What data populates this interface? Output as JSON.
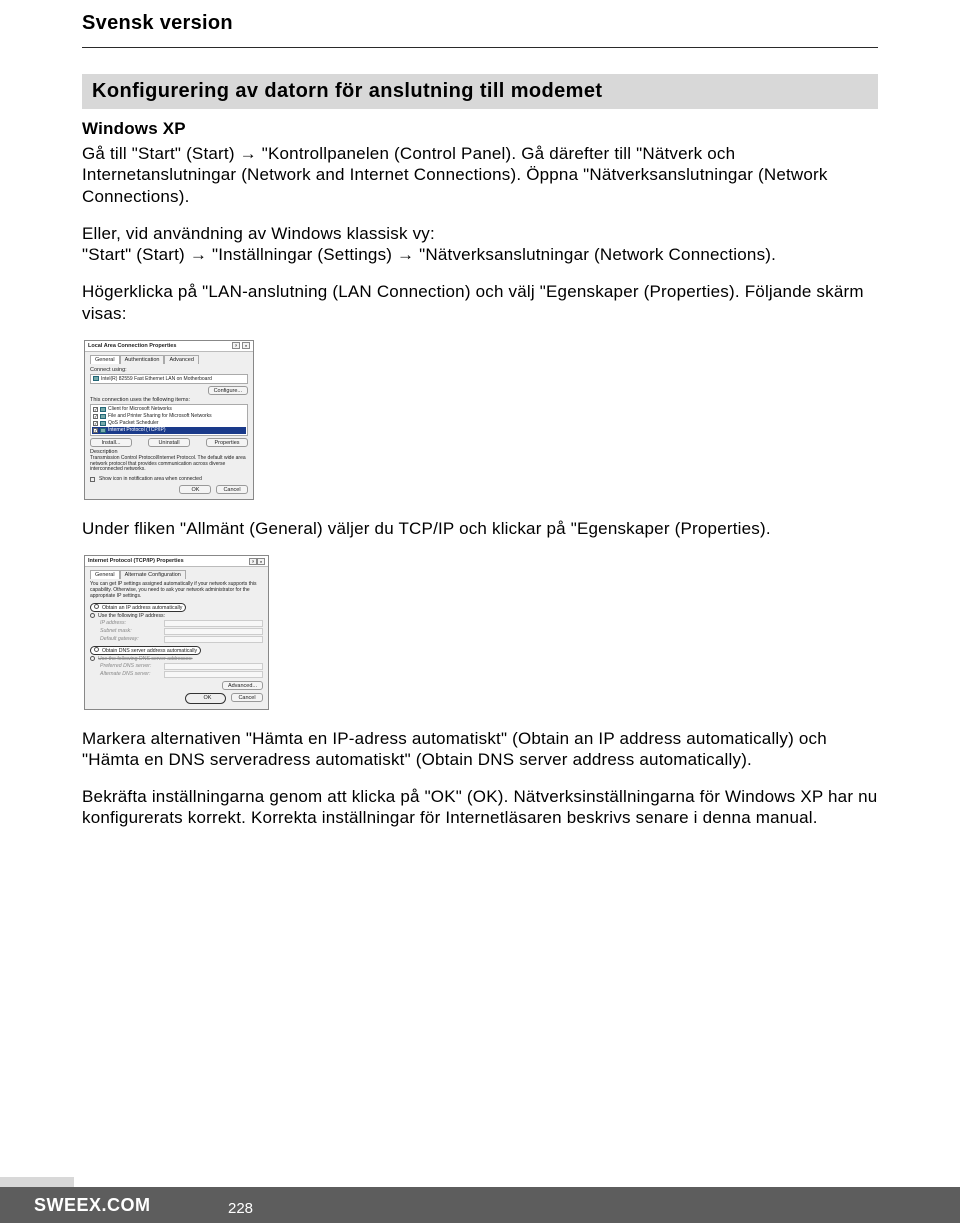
{
  "header": {
    "title": "Svensk version"
  },
  "section_title": "Konfigurering av datorn för anslutning till modemet",
  "sub_windowsxp": "Windows XP",
  "para1": "Gå till \"Start\" (Start) → \"Kontrollpanelen (Control Panel). Gå därefter till \"Nätverk och Internetanslutningar (Network and Internet Connections). Öppna \"Nätverksanslutningar (Network Connections).",
  "para2a": "Eller, vid användning av Windows klassisk vy:",
  "para2b": "\"Start\" (Start) → \"Inställningar (Settings) → \"Nätverksanslutningar (Network Connections).",
  "para3": "Högerklicka på \"LAN-anslutning (LAN Connection) och välj \"Egenskaper (Properties). Följande skärm visas:",
  "dialog1": {
    "title": "Local Area Connection Properties",
    "tab_general": "General",
    "tab_auth": "Authentication",
    "tab_adv": "Advanced",
    "connect_using": "Connect using:",
    "adapter": "Intel(R) 82559 Fast Ethernet LAN on Motherboard",
    "configure": "Configure...",
    "uses_items": "This connection uses the following items:",
    "item1": "Client for Microsoft Networks",
    "item2": "File and Printer Sharing for Microsoft Networks",
    "item3": "QoS Packet Scheduler",
    "item4": "Internet Protocol (TCP/IP)",
    "install": "Install...",
    "uninstall": "Uninstall",
    "properties": "Properties",
    "desc_label": "Description",
    "desc_text": "Transmission Control Protocol/Internet Protocol. The default wide area network protocol that provides communication across diverse interconnected networks.",
    "show_icon": "Show icon in notification area when connected",
    "ok": "OK",
    "cancel": "Cancel"
  },
  "para4": "Under fliken \"Allmänt (General) väljer du TCP/IP och klickar på \"Egenskaper (Properties).",
  "dialog2": {
    "title": "Internet Protocol (TCP/IP) Properties",
    "tab_general": "General",
    "tab_alt": "Alternate Configuration",
    "blurb": "You can get IP settings assigned automatically if your network supports this capability. Otherwise, you need to ask your network administrator for the appropriate IP settings.",
    "opt_auto_ip": "Obtain an IP address automatically",
    "opt_use_ip": "Use the following IP address:",
    "ip_addr": "IP address:",
    "subnet": "Subnet mask:",
    "gateway": "Default gateway:",
    "opt_auto_dns": "Obtain DNS server address automatically",
    "opt_use_dns": "Use the following DNS server addresses:",
    "pref_dns": "Preferred DNS server:",
    "alt_dns": "Alternate DNS server:",
    "advanced": "Advanced...",
    "ok": "OK",
    "cancel": "Cancel"
  },
  "para5": "Markera alternativen \"Hämta en IP-adress automatiskt\" (Obtain an IP address automatically) och \"Hämta en DNS serveradress automatiskt\" (Obtain DNS server address automatically).",
  "para6": "Bekräfta inställningarna genom att klicka på \"OK\" (OK). Nätverksinställningarna för Windows XP har nu konfigurerats korrekt. Korrekta inställningar för Internetläsaren beskrivs senare i denna manual.",
  "footer": {
    "brand": "SWEEX.COM",
    "page": "228"
  }
}
